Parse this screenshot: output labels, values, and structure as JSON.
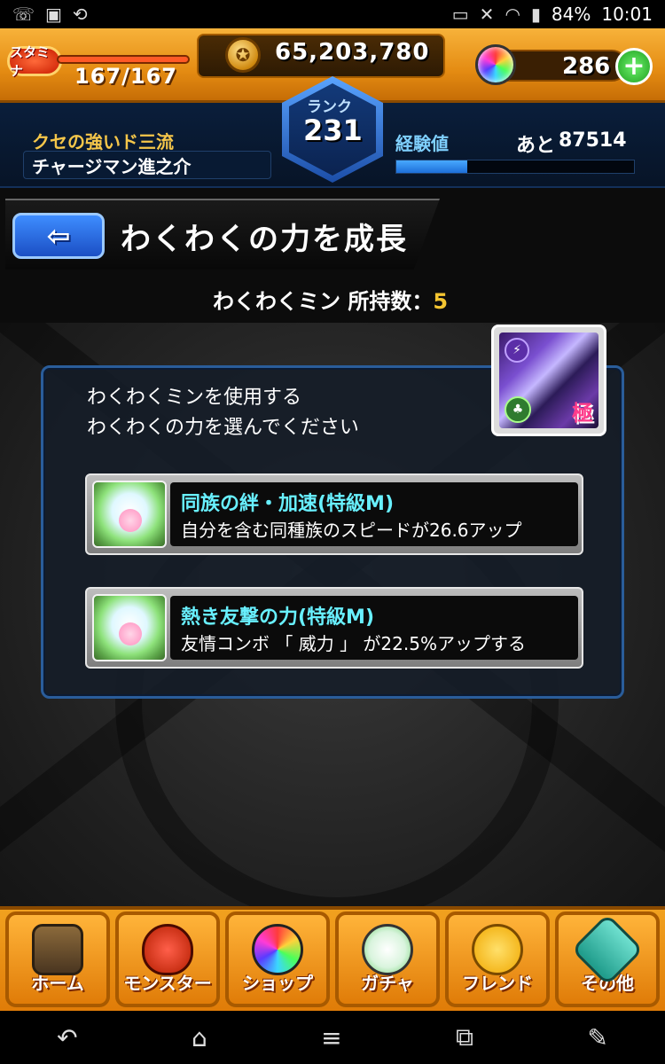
{
  "status_bar": {
    "battery": "84%",
    "time": "10:01",
    "left_icons": [
      "wifi-calling-icon",
      "image-icon",
      "screen-rotation-icon"
    ],
    "right_icons": [
      "vr-icon",
      "mute-icon",
      "wifi-icon",
      "signal-icon"
    ]
  },
  "hud": {
    "stamina_label": "スタミナ",
    "stamina_value": "167/167",
    "gold_value": "65,203,780",
    "orb_count": "286",
    "plus_label": "+"
  },
  "player": {
    "title": "クセの強いド三流",
    "name": "チャージマン進之介",
    "rank_label": "ランク",
    "rank_value": "231",
    "exp_label": "経験値",
    "exp_remaining_label": "あと",
    "exp_remaining_value": "87514",
    "exp_progress": 0.3
  },
  "page": {
    "back_label": "⇦",
    "title": "わくわくの力を成長",
    "count_label": "わくわくミン 所持数：",
    "count_value": "5"
  },
  "monster": {
    "badge_top": "⚡",
    "badge_bottom": "♣",
    "rank_kanji": "極"
  },
  "dialog": {
    "line1": "わくわくミンを使用する",
    "line2": "わくわくの力を選んでください",
    "options": [
      {
        "title": "同族の絆・加速(特級M)",
        "desc": "自分を含む同種族のスピードが26.6アップ"
      },
      {
        "title": "熱き友撃の力(特級M)",
        "desc": "友情コンボ 「 威力 」 が22.5%アップする"
      }
    ]
  },
  "bottom_nav": {
    "items": [
      {
        "label": "ホーム",
        "icon": "home-icon"
      },
      {
        "label": "モンスター",
        "icon": "monster-icon"
      },
      {
        "label": "ショップ",
        "icon": "orb-shop-icon"
      },
      {
        "label": "ガチャ",
        "icon": "egg-gacha-icon"
      },
      {
        "label": "フレンド",
        "icon": "friend-icon"
      },
      {
        "label": "その他",
        "icon": "other-icon"
      }
    ]
  },
  "android_nav": {
    "icons": [
      "back-icon",
      "home-icon",
      "menu-icon",
      "recent-apps-icon",
      "edit-icon"
    ]
  },
  "colors": {
    "hud_orange": "#e48b12",
    "rank_blue": "#1c4ea8",
    "option_title_cyan": "#68f0ff",
    "count_yellow": "#f4c531"
  }
}
